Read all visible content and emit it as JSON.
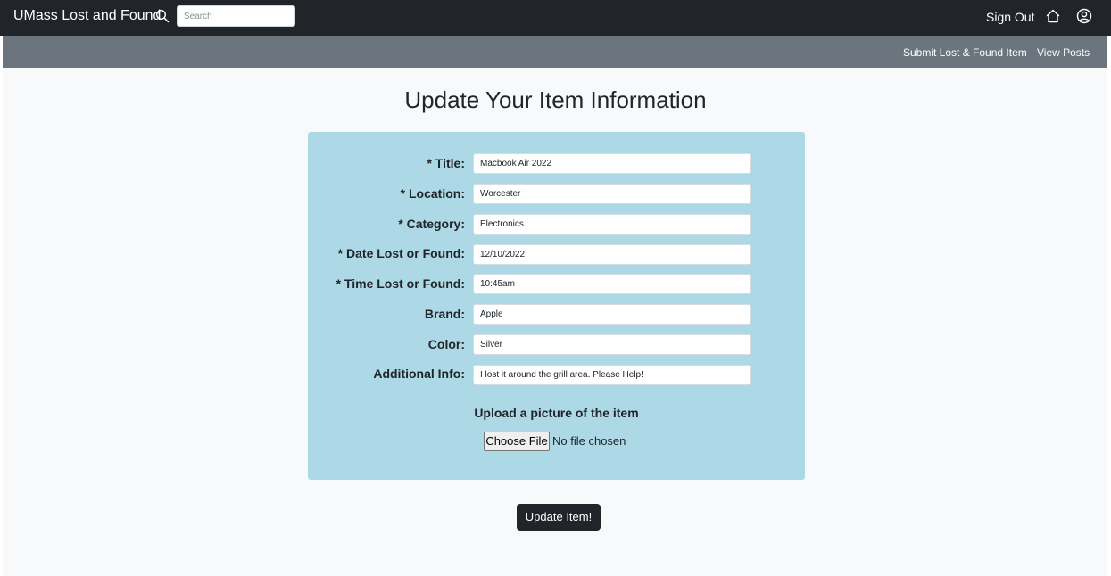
{
  "navbar": {
    "brand": "UMass Lost and Found",
    "search_placeholder": "Search",
    "sign_out_label": "Sign Out"
  },
  "subnav": {
    "submit_label": "Submit Lost & Found Item",
    "view_posts_label": "View Posts"
  },
  "page_title": "Update Your Item Information",
  "form": {
    "fields": [
      {
        "label": "* Title:",
        "value": "Macbook Air 2022"
      },
      {
        "label": "* Location:",
        "value": "Worcester"
      },
      {
        "label": "* Category:",
        "value": "Electronics"
      },
      {
        "label": "* Date Lost or Found:",
        "value": "12/10/2022"
      },
      {
        "label": "* Time Lost or Found:",
        "value": "10:45am"
      },
      {
        "label": "Brand:",
        "value": "Apple"
      },
      {
        "label": "Color:",
        "value": "Silver"
      },
      {
        "label": "Additional Info:",
        "value": "I lost it around the grill area. Please Help!"
      }
    ],
    "upload_label": "Upload a picture of the item",
    "choose_file_label": "Choose File",
    "file_status": "No file chosen"
  },
  "submit_button": "Update Item!",
  "colors": {
    "navbar_bg": "#212529",
    "subnav_bg": "#6c757d",
    "panel_bg": "#add8e6",
    "page_bg": "#f8f9fa"
  },
  "icons": {
    "search": "search-icon",
    "home": "home-icon",
    "user": "user-circle-icon"
  }
}
